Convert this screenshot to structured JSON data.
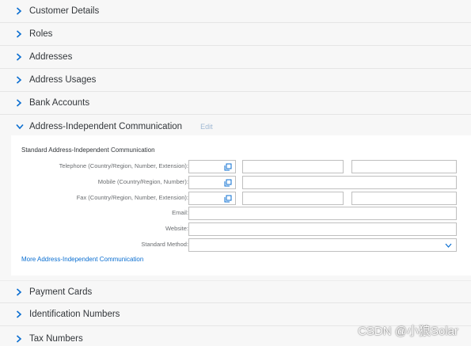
{
  "sections": {
    "customer_details": "Customer Details",
    "roles": "Roles",
    "addresses": "Addresses",
    "address_usages": "Address Usages",
    "bank_accounts": "Bank Accounts",
    "address_independent": "Address-Independent Communication",
    "payment_cards": "Payment Cards",
    "identification_numbers": "Identification Numbers",
    "tax_numbers": "Tax Numbers"
  },
  "edit_label": "Edit",
  "communication": {
    "section_title": "Standard Address-Independent Communication",
    "telephone_label": "Telephone (Country/Region, Number, Extension):",
    "mobile_label": "Mobile (Country/Region, Number):",
    "fax_label": "Fax (Country/Region, Number, Extension):",
    "email_label": "Email:",
    "website_label": "Website:",
    "standard_method_label": "Standard Method:",
    "more_link": "More Address-Independent Communication"
  },
  "watermark": "CSDN @小狼Solar",
  "colors": {
    "background": "#f7f7f7",
    "content": "#ffffff",
    "link": "#0a6ed1",
    "icon_blue": "#0a6ed1",
    "text": "#32363a",
    "label": "#6a6d70",
    "field_border": "#bfbfbf"
  },
  "icons": {
    "collapsed": "chevron-right-icon",
    "expanded": "chevron-down-icon",
    "value_help": "value-help-icon",
    "dropdown": "chevron-down-icon"
  }
}
